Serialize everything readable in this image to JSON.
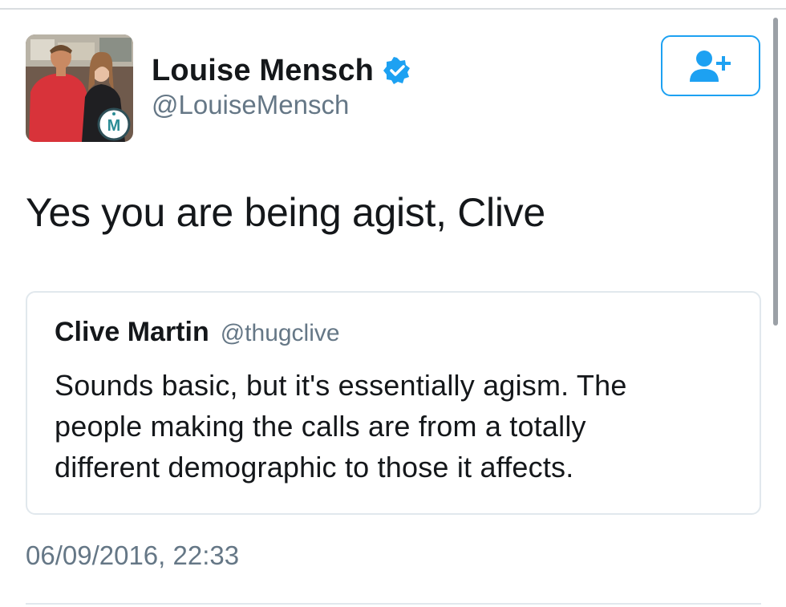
{
  "author": {
    "display_name": "Louise Mensch",
    "handle": "@LouiseMensch",
    "verified": true,
    "avatar_badge_letter": "M"
  },
  "follow_button": {
    "icon": "add-user-icon"
  },
  "tweet": {
    "text": "Yes you are being agist, Clive",
    "timestamp": "06/09/2016, 22:33"
  },
  "quoted_tweet": {
    "display_name": "Clive Martin",
    "handle": "@thugclive",
    "lines": [
      "Sounds basic, but it's essentially agism. The",
      "people making the calls are from a totally",
      "different demographic to those it affects."
    ]
  },
  "colors": {
    "accent": "#1da1f2",
    "text_primary": "#14171a",
    "text_secondary": "#657786",
    "border": "#e1e8ed"
  }
}
